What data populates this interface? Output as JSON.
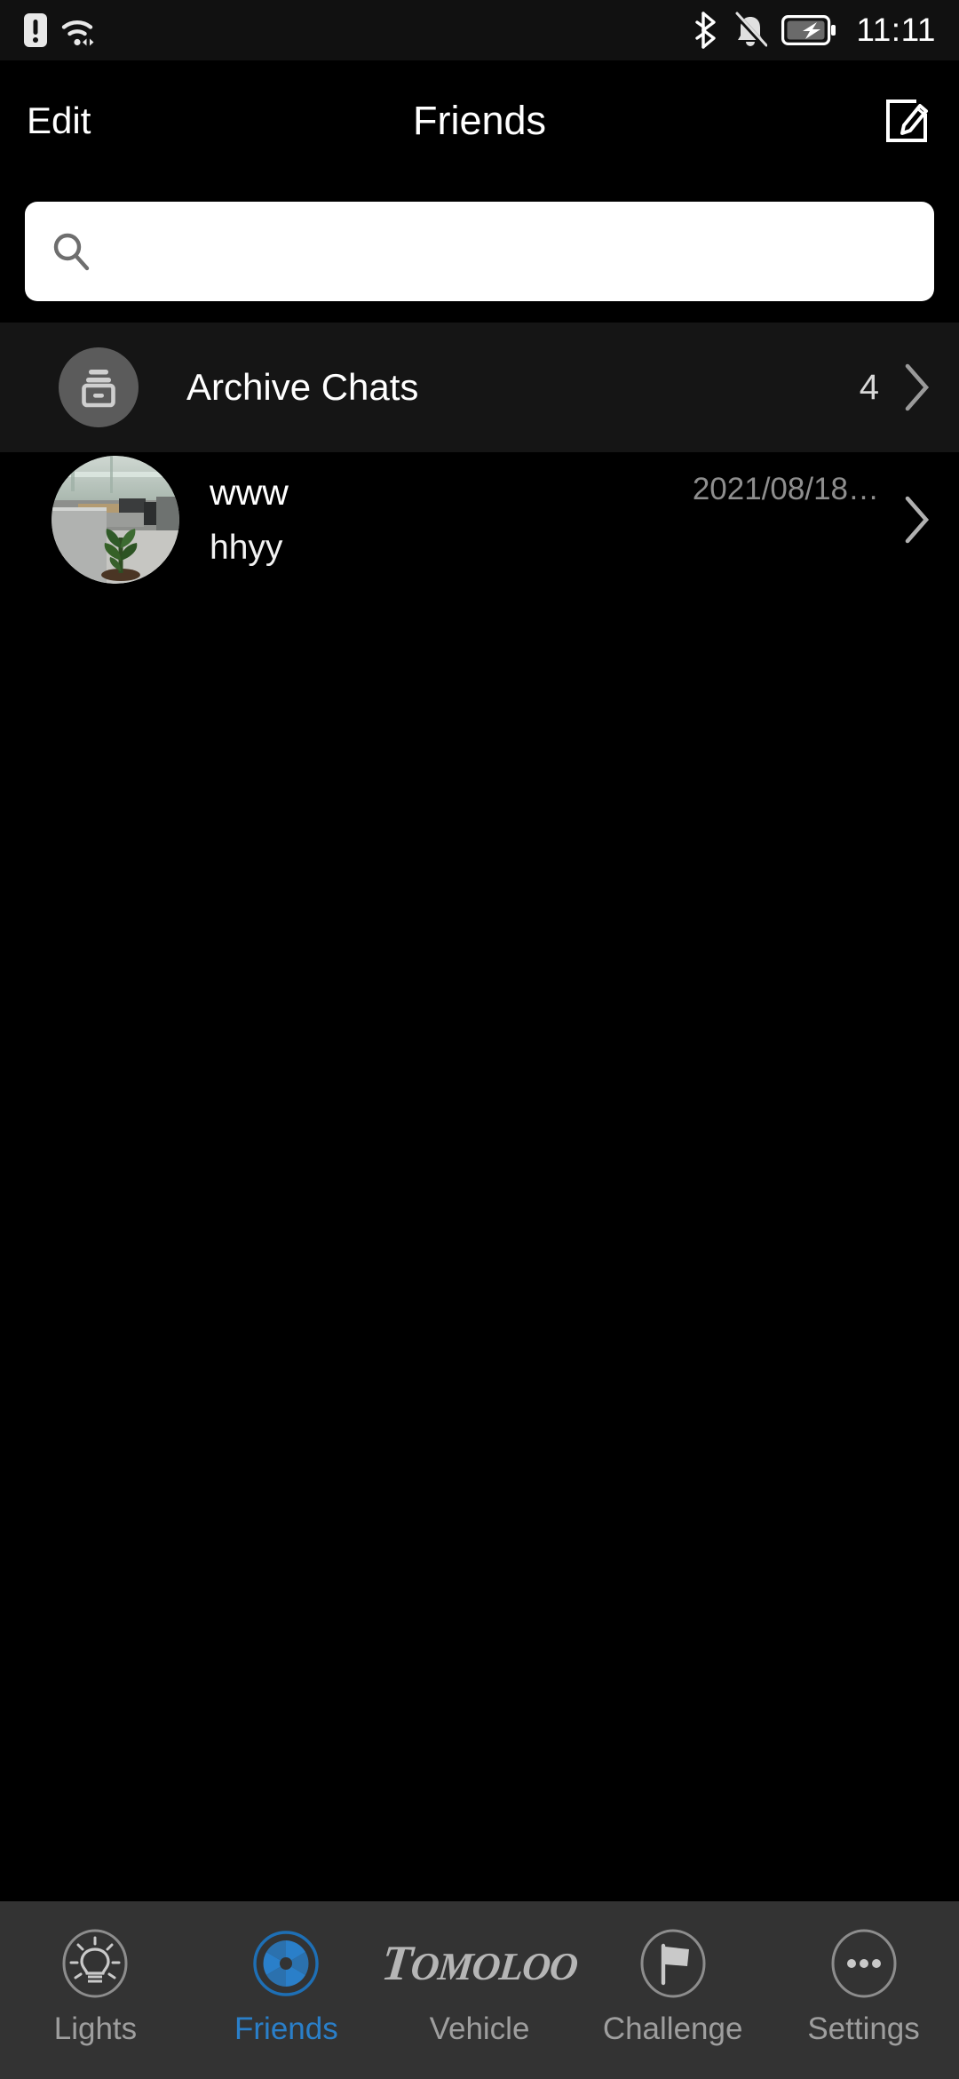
{
  "statusbar": {
    "time": "11:11",
    "icons": [
      "sim-alert-icon",
      "wifi-icon",
      "bluetooth-icon",
      "bell-muted-icon",
      "battery-charging-icon"
    ]
  },
  "header": {
    "edit_label": "Edit",
    "title": "Friends",
    "compose_icon": "compose-pencil-icon"
  },
  "search": {
    "value": "",
    "placeholder": "",
    "icon": "search-icon"
  },
  "archive": {
    "label": "Archive Chats",
    "count": "4",
    "avatar_icon": "archive-box-icon",
    "chevron_icon": "chevron-right-icon",
    "avatar_bg": "#5b5b5b",
    "row_bg": "#151515"
  },
  "friends": [
    {
      "name": "www",
      "message": "hhyy",
      "date": "2021/08/18…",
      "avatar": "office-photo-avatar",
      "chevron_icon": "chevron-right-icon"
    }
  ],
  "tabbar": {
    "bg": "#333333",
    "active_color": "#2a7fc9",
    "inactive_color": "#9e9e9e",
    "items": [
      {
        "label": "Lights",
        "icon": "lightbulb-icon",
        "active": false
      },
      {
        "label": "Friends",
        "icon": "aperture-icon",
        "active": true
      },
      {
        "label": "Vehicle",
        "icon": "tomoloo-logo",
        "active": false,
        "logo_cap": "T",
        "logo_rest": "OMOLOO"
      },
      {
        "label": "Challenge",
        "icon": "flag-icon",
        "active": false
      },
      {
        "label": "Settings",
        "icon": "ellipsis-icon",
        "active": false
      }
    ]
  }
}
